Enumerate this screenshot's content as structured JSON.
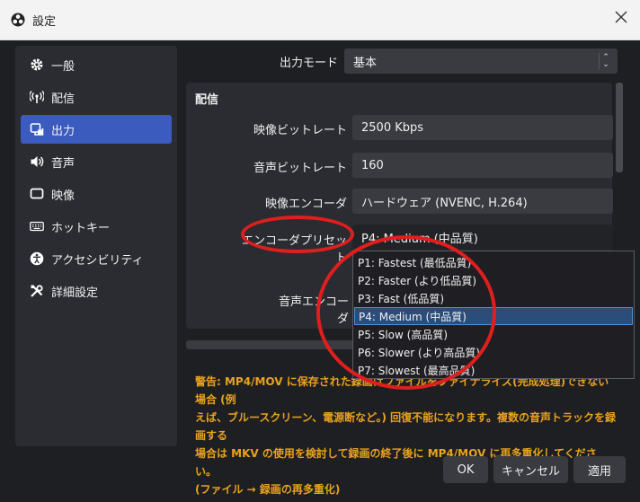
{
  "window": {
    "title": "設定"
  },
  "sidebar": {
    "items": [
      {
        "label": "一般",
        "icon": "gear-icon"
      },
      {
        "label": "配信",
        "icon": "broadcast-icon"
      },
      {
        "label": "出力",
        "icon": "output-icon",
        "active": true
      },
      {
        "label": "音声",
        "icon": "speaker-icon"
      },
      {
        "label": "映像",
        "icon": "monitor-icon"
      },
      {
        "label": "ホットキー",
        "icon": "keyboard-icon"
      },
      {
        "label": "アクセシビリティ",
        "icon": "accessibility-icon"
      },
      {
        "label": "詳細設定",
        "icon": "tools-icon"
      }
    ]
  },
  "output_mode": {
    "label": "出力モード",
    "value": "基本"
  },
  "streaming_group": {
    "title": "配信",
    "video_bitrate": {
      "label": "映像ビットレート",
      "value": "2500 Kbps"
    },
    "audio_bitrate": {
      "label": "音声ビットレート",
      "value": "160"
    },
    "video_encoder": {
      "label": "映像エンコーダ",
      "value": "ハードウェア (NVENC, H.264)"
    },
    "encoder_preset": {
      "label": "エンコーダプリセット",
      "value": "P4: Medium (中品質)"
    },
    "audio_encoder": {
      "label": "音声エンコーダ"
    }
  },
  "preset_dropdown": {
    "options": [
      "P1: Fastest (最低品質)",
      "P2: Faster (より低品質)",
      "P3: Fast (低品質)",
      "P4: Medium (中品質)",
      "P5: Slow (高品質)",
      "P6: Slower (より高品質)",
      "P7: Slowest (最高品質)"
    ],
    "selected": "P4: Medium (中品質)"
  },
  "warning": {
    "line1": "警告: MP4/MOV に保存された録画はファイルをファイナライズ(完成処理)できない場合 (例",
    "line2": "えば、ブルースクリーン、電源断など。) 回復不能になります。複数の音声トラックを録画する",
    "line3": "場合は MKV の使用を検討して録画の終了後に MP4/MOV に再多重化してください。",
    "line4": "(ファイル → 録画の再多重化)"
  },
  "buttons": {
    "ok": "OK",
    "cancel": "キャンセル",
    "apply": "適用"
  },
  "colors": {
    "accent": "#3b5bbf",
    "warning": "#e8a21e",
    "annotation": "#e01e1e"
  }
}
